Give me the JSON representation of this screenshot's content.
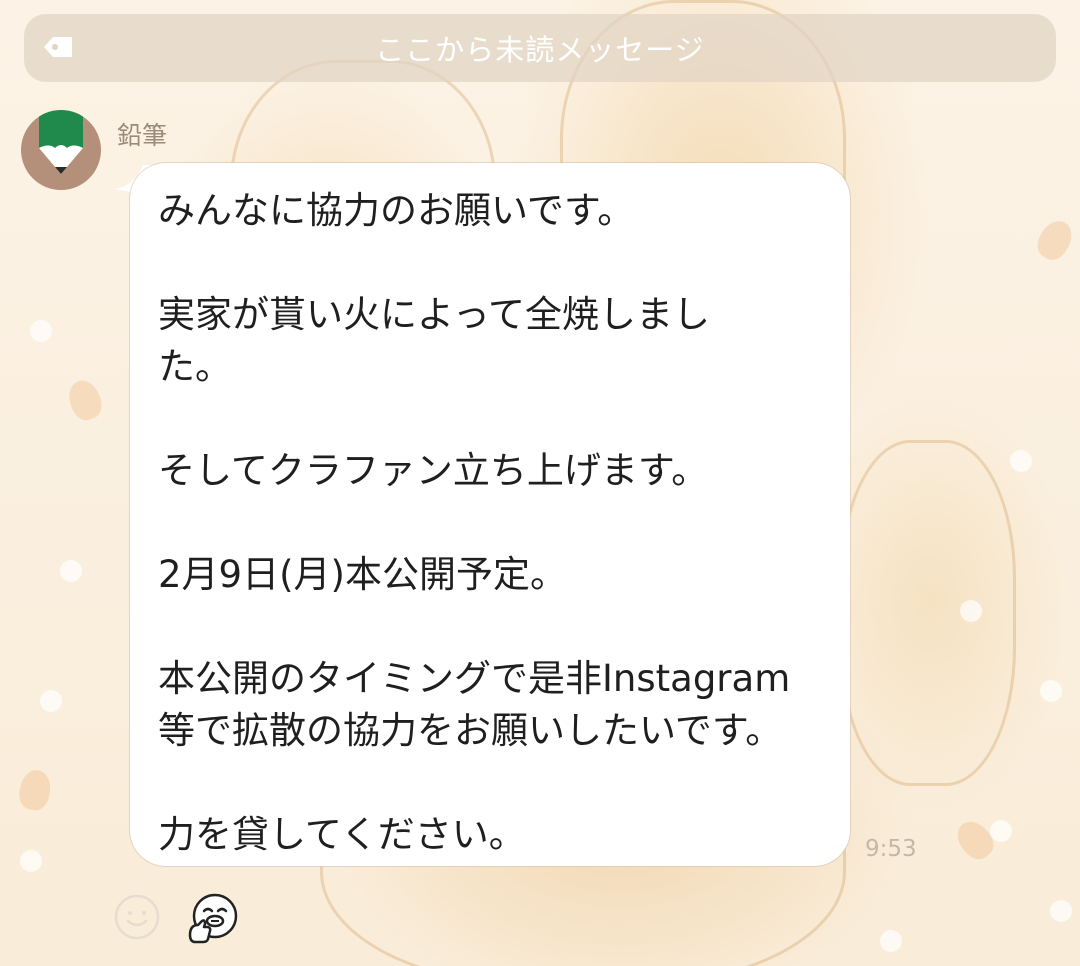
{
  "unread_banner": {
    "text": "ここから未読メッセージ",
    "icon": "tag-icon"
  },
  "message": {
    "sender_name": "鉛筆",
    "avatar_icon": "pencil-avatar-icon",
    "lines": [
      "みんなに協力のお願いです。",
      "実家が貰い火によって全焼しまし\nた。",
      "そしてクラファン立ち上げます。",
      "2月9日(月)本公開予定。",
      "本公開のタイミングで是非Instagram\n等で拡散の協力をお願いしたいです。",
      "力を貸してください。"
    ],
    "time": "9:53"
  },
  "reactions": {
    "smile_icon": "smile-reaction-icon",
    "sticker_icon": "thumbs-up-sticker-icon"
  },
  "colors": {
    "background": "#fbf1e3",
    "bubble": "#ffffff",
    "avatar_bg": "#b4907a",
    "pencil_green": "#1f8a4c",
    "text": "#1f1f1f",
    "meta_text": "#9c8a78"
  }
}
